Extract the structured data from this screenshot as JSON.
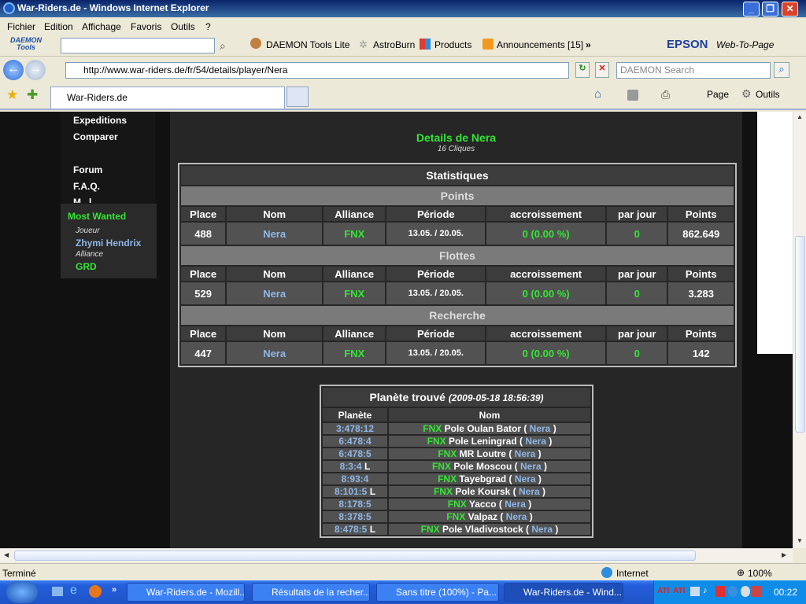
{
  "window": {
    "title": "War-Riders.de - Windows Internet Explorer"
  },
  "menu": [
    "Fichier",
    "Edition",
    "Affichage",
    "Favoris",
    "Outils",
    "?"
  ],
  "toolbar": {
    "daemon_logo": "DAEMON Tools",
    "daemon_lite": "DAEMON Tools Lite",
    "astroburn": "AstroBurn",
    "products": "Products",
    "announcements": "Announcements [15]",
    "epson": "EPSON",
    "web_to_page": "Web-To-Page"
  },
  "address": {
    "url": "http://www.war-riders.de/fr/54/details/player/Nera",
    "search_placeholder": "DAEMON Search"
  },
  "tabs": {
    "active": "War-Riders.de",
    "page": "Page",
    "tools": "Outils"
  },
  "sidebar": {
    "links": [
      "Expeditions",
      "Comparer",
      "Forum",
      "F.A.Q.",
      "M...l...",
      "Most Wanted"
    ],
    "joueur_label": "Joueur",
    "joueur_name": "Zhymi Hendrix",
    "alliance_label": "Alliance",
    "alliance_name": "GRD"
  },
  "details": {
    "title": "Details de Nera",
    "subtitle": "16 Cliques"
  },
  "stats": {
    "title": "Statistiques",
    "headers": [
      "Place",
      "Nom",
      "Alliance",
      "Période",
      "accroissement",
      "par jour",
      "Points"
    ],
    "sections": [
      {
        "name": "Points",
        "row": {
          "place": "488",
          "nom": "Nera",
          "alliance": "FNX",
          "periode": "13.05. / 20.05.",
          "accroissement": "0 (0.00 %)",
          "par_jour": "0",
          "points": "862.649"
        }
      },
      {
        "name": "Flottes",
        "row": {
          "place": "529",
          "nom": "Nera",
          "alliance": "FNX",
          "periode": "13.05. / 20.05.",
          "accroissement": "0 (0.00 %)",
          "par_jour": "0",
          "points": "3.283"
        }
      },
      {
        "name": "Recherche",
        "row": {
          "place": "447",
          "nom": "Nera",
          "alliance": "FNX",
          "periode": "13.05. / 20.05.",
          "accroissement": "0 (0.00 %)",
          "par_jour": "0",
          "points": "142"
        }
      }
    ]
  },
  "planets": {
    "title": "Planète trouvé",
    "date": "(2009-05-18 18:56:39)",
    "headers": [
      "Planète",
      "Nom"
    ],
    "rows": [
      {
        "coord": "3:478:12",
        "flag": "",
        "alliance": "FNX",
        "name": "Pole Oulan Bator",
        "owner": "Nera"
      },
      {
        "coord": "6:478:4",
        "flag": "",
        "alliance": "FNX",
        "name": "Pole Leningrad",
        "owner": "Nera"
      },
      {
        "coord": "6:478:5",
        "flag": "",
        "alliance": "FNX",
        "name": "MR Loutre",
        "owner": "Nera"
      },
      {
        "coord": "8:3:4",
        "flag": "L",
        "alliance": "FNX",
        "name": "Pole Moscou",
        "owner": "Nera"
      },
      {
        "coord": "8:93:4",
        "flag": "",
        "alliance": "FNX",
        "name": "Tayebgrad",
        "owner": "Nera"
      },
      {
        "coord": "8:101:5",
        "flag": "L",
        "alliance": "FNX",
        "name": "Pole Koursk",
        "owner": "Nera"
      },
      {
        "coord": "8:178:5",
        "flag": "",
        "alliance": "FNX",
        "name": "Yacco",
        "owner": "Nera"
      },
      {
        "coord": "8:378:5",
        "flag": "",
        "alliance": "FNX",
        "name": "Valpaz",
        "owner": "Nera"
      },
      {
        "coord": "8:478:5",
        "flag": "L",
        "alliance": "FNX",
        "name": "Pole Vladivostock",
        "owner": "Nera"
      }
    ]
  },
  "status": {
    "left": "Terminé",
    "zone": "Internet",
    "zoom": "100%"
  },
  "taskbar": {
    "items": [
      "War-Riders.de - Mozill...",
      "Résultats de la recher...",
      "Sans titre (100%) - Pa...",
      "War-Riders.de - Wind..."
    ],
    "clock": "00:22"
  }
}
